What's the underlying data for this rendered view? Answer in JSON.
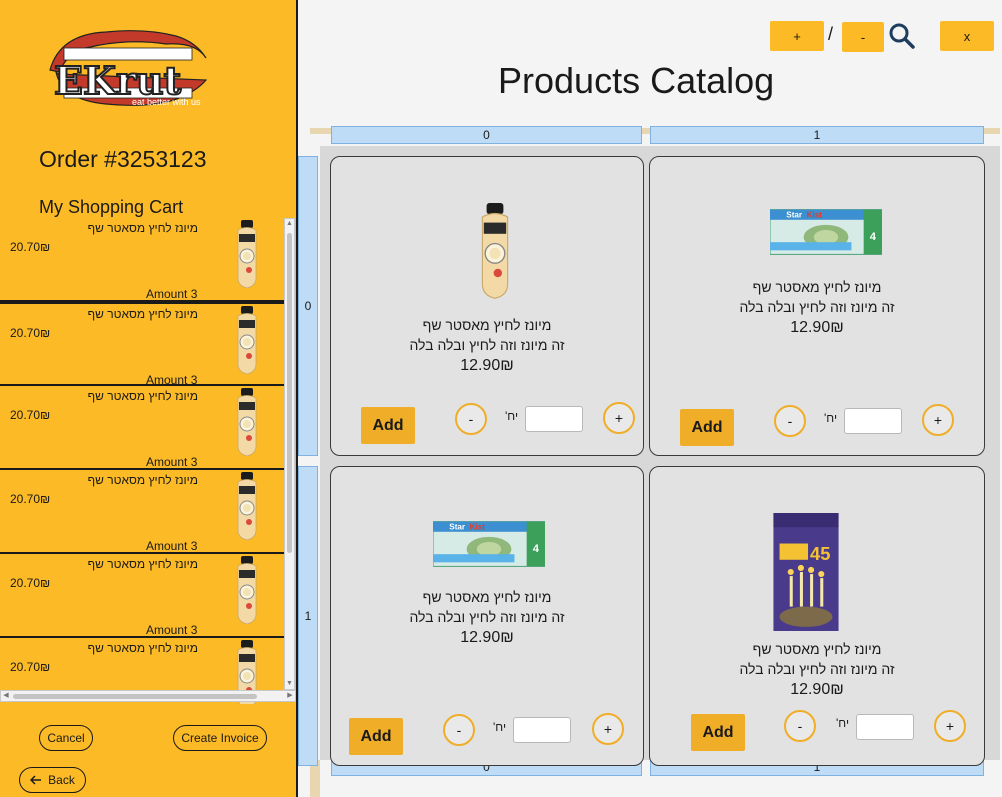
{
  "brand": {
    "logo_text": "EKrut",
    "tagline": "eat better with us"
  },
  "order": {
    "title": "Order #3253123"
  },
  "cart": {
    "title": "My Shopping Cart",
    "items": [
      {
        "name": "מיונז לחיץ מסאטר שף",
        "price": "20.70₪",
        "amount": "Amount 3"
      },
      {
        "name": "מיונז לחיץ מסאטר שף",
        "price": "20.70₪",
        "amount": "Amount 3"
      },
      {
        "name": "מיונז לחיץ מסאטר שף",
        "price": "20.70₪",
        "amount": "Amount 3"
      },
      {
        "name": "מיונז לחיץ מסאטר שף",
        "price": "20.70₪",
        "amount": "Amount 3"
      },
      {
        "name": "מיונז לחיץ מסאטר שף",
        "price": "20.70₪",
        "amount": "Amount 3"
      },
      {
        "name": "מיונז לחיץ מסאטר שף",
        "price": "20.70₪",
        "amount": ""
      }
    ]
  },
  "actions": {
    "cancel": "Cancel",
    "create_invoice": "Create Invoice",
    "back": "Back"
  },
  "toolbar": {
    "zoom_in": "+",
    "separator": "/",
    "zoom_out": "-",
    "close": "x"
  },
  "catalog": {
    "title": "Products Catalog",
    "col_headers": [
      "0",
      "1"
    ],
    "row_headers": [
      "0",
      "1"
    ],
    "products": [
      {
        "name": "מיונז לחיץ מאסטר שף",
        "desc": "זה מיונז וזה לחיץ ובלה בלה",
        "price": "12.90₪",
        "image": "mayo-bottle",
        "add": "Add",
        "minus": "-",
        "plus": "+",
        "unit": "יח'",
        "qty": ""
      },
      {
        "name": "מיונז לחיץ מאסטר שף",
        "desc": "זה מיונז וזה לחיץ ובלה בלה",
        "price": "12.90₪",
        "image": "tuna-pack",
        "add": "Add",
        "minus": "-",
        "plus": "+",
        "unit": "יח'",
        "qty": ""
      },
      {
        "name": "מיונז לחיץ מאסטר שף",
        "desc": "זה מיונז וזה לחיץ ובלה בלה",
        "price": "12.90₪",
        "image": "tuna-pack",
        "add": "Add",
        "minus": "-",
        "plus": "+",
        "unit": "יח'",
        "qty": ""
      },
      {
        "name": "מיונז לחיץ מאסטר שף",
        "desc": "זה מיונז וזה לחיץ ובלה בלה",
        "price": "12.90₪",
        "image": "candles-box",
        "add": "Add",
        "minus": "-",
        "plus": "+",
        "unit": "יח'",
        "qty": ""
      }
    ]
  },
  "colors": {
    "brand_yellow": "#fcba26",
    "button_orange": "#f0ad28",
    "header_blue": "#bfdcf7"
  }
}
